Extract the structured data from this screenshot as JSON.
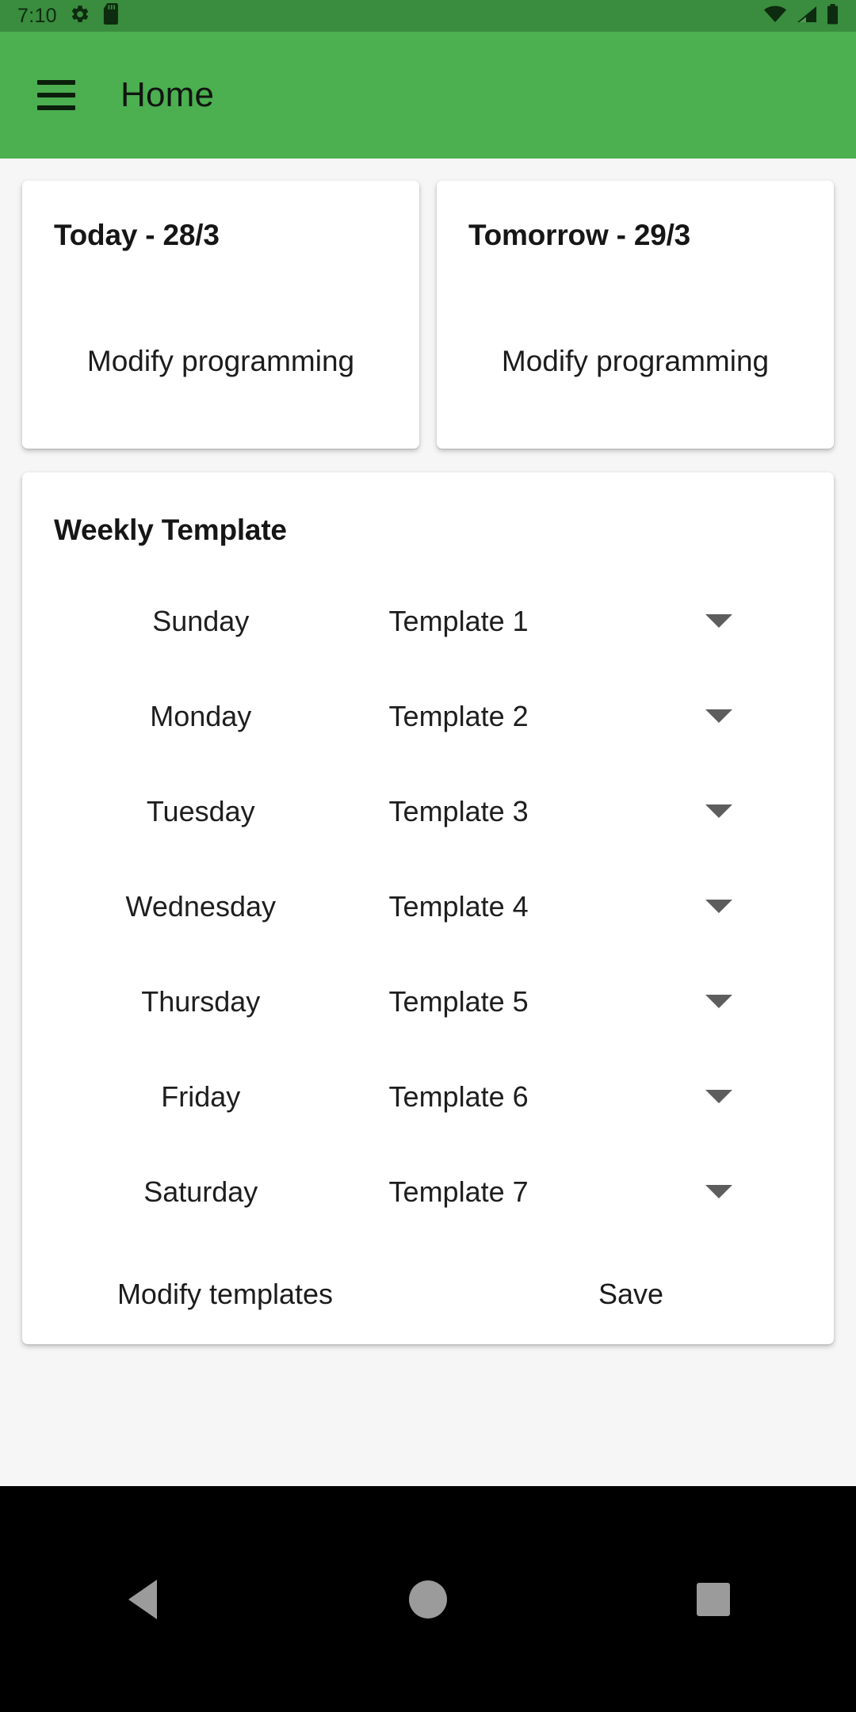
{
  "status_bar": {
    "time": "7:10",
    "left_icons": [
      "gear-icon",
      "sd-card-icon"
    ],
    "right_icons": [
      "wifi-icon",
      "cellular-signal-icon",
      "battery-icon"
    ],
    "background_color": "#3a8c3e"
  },
  "app_bar": {
    "menu_icon": "hamburger-menu-icon",
    "title": "Home",
    "background_color": "#4caf50"
  },
  "day_cards": [
    {
      "title": "Today - 28/3",
      "action_label": "Modify programming"
    },
    {
      "title": "Tomorrow - 29/3",
      "action_label": "Modify programming"
    }
  ],
  "weekly_template": {
    "title": "Weekly Template",
    "rows": [
      {
        "day": "Sunday",
        "template": "Template 1",
        "dropdown_icon": "chevron-down-icon"
      },
      {
        "day": "Monday",
        "template": "Template 2",
        "dropdown_icon": "chevron-down-icon"
      },
      {
        "day": "Tuesday",
        "template": "Template 3",
        "dropdown_icon": "chevron-down-icon"
      },
      {
        "day": "Wednesday",
        "template": "Template 4",
        "dropdown_icon": "chevron-down-icon"
      },
      {
        "day": "Thursday",
        "template": "Template 5",
        "dropdown_icon": "chevron-down-icon"
      },
      {
        "day": "Friday",
        "template": "Template 6",
        "dropdown_icon": "chevron-down-icon"
      },
      {
        "day": "Saturday",
        "template": "Template 7",
        "dropdown_icon": "chevron-down-icon"
      }
    ],
    "modify_templates_label": "Modify templates",
    "save_label": "Save"
  },
  "nav_bar": {
    "back_icon": "back-triangle-icon",
    "home_icon": "home-circle-icon",
    "recents_icon": "recents-square-icon",
    "background_color": "#000000"
  }
}
